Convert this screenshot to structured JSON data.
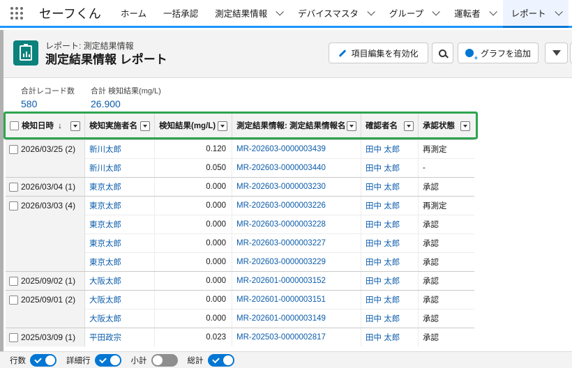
{
  "app": {
    "name": "セーフくん"
  },
  "nav": [
    {
      "label": "ホーム",
      "has_menu": false,
      "active": false
    },
    {
      "label": "一括承認",
      "has_menu": false,
      "active": false
    },
    {
      "label": "測定結果情報",
      "has_menu": true,
      "active": false
    },
    {
      "label": "デバイスマスタ",
      "has_menu": true,
      "active": false
    },
    {
      "label": "グループ",
      "has_menu": true,
      "active": false
    },
    {
      "label": "運転者",
      "has_menu": true,
      "active": false
    },
    {
      "label": "レポート",
      "has_menu": true,
      "active": true
    }
  ],
  "header": {
    "breadcrumb": "レポート: 測定結果情報",
    "title": "測定結果情報 レポート",
    "edit_button": "項目編集を有効化",
    "add_chart_button": "グラフを追加"
  },
  "summary": [
    {
      "label": "合計レコード数",
      "value": "580"
    },
    {
      "label": "合計 検知結果(mg/L)",
      "value": "26.900"
    }
  ],
  "table": {
    "columns": [
      "検知日時",
      "検知実施者名",
      "検知結果(mg/L)",
      "測定結果情報: 測定結果情報名",
      "確認者名",
      "承認状態"
    ],
    "sort_indicator": "↓",
    "groups": [
      {
        "label": "2026/03/25 (2)",
        "rows": [
          {
            "name": "新川太郎",
            "value": "0.120",
            "id": "MR-202603-0000003439",
            "confirmer": "田中 太郎",
            "status": "再測定"
          },
          {
            "name": "新川太郎",
            "value": "0.050",
            "id": "MR-202603-0000003440",
            "confirmer": "田中 太郎",
            "status": "-"
          }
        ]
      },
      {
        "label": "2026/03/04 (1)",
        "rows": [
          {
            "name": "東京太郎",
            "value": "0.000",
            "id": "MR-202603-0000003230",
            "confirmer": "田中 太郎",
            "status": "承認"
          }
        ]
      },
      {
        "label": "2026/03/03 (4)",
        "rows": [
          {
            "name": "東京太郎",
            "value": "0.000",
            "id": "MR-202603-0000003226",
            "confirmer": "田中 太郎",
            "status": "再測定"
          },
          {
            "name": "東京太郎",
            "value": "0.000",
            "id": "MR-202603-0000003228",
            "confirmer": "田中 太郎",
            "status": "承認"
          },
          {
            "name": "東京太郎",
            "value": "0.000",
            "id": "MR-202603-0000003227",
            "confirmer": "田中 太郎",
            "status": "承認"
          },
          {
            "name": "東京太郎",
            "value": "0.000",
            "id": "MR-202603-0000003229",
            "confirmer": "田中 太郎",
            "status": "承認"
          }
        ]
      },
      {
        "label": "2025/09/02 (1)",
        "rows": [
          {
            "name": "大阪太郎",
            "value": "0.000",
            "id": "MR-202601-0000003152",
            "confirmer": "田中 太郎",
            "status": "承認"
          }
        ]
      },
      {
        "label": "2025/09/01 (2)",
        "rows": [
          {
            "name": "大阪太郎",
            "value": "0.000",
            "id": "MR-202601-0000003151",
            "confirmer": "田中 太郎",
            "status": "承認"
          },
          {
            "name": "大阪太郎",
            "value": "0.000",
            "id": "MR-202601-0000003149",
            "confirmer": "田中 太郎",
            "status": "承認"
          }
        ]
      },
      {
        "label": "2025/03/09 (1)",
        "rows": [
          {
            "name": "平田政宗",
            "value": "0.023",
            "id": "MR-202503-0000002817",
            "confirmer": "田中 太郎",
            "status": "承認"
          }
        ]
      }
    ]
  },
  "footer": {
    "toggles": [
      {
        "label": "行数",
        "on": true
      },
      {
        "label": "詳細行",
        "on": true
      },
      {
        "label": "小計",
        "on": false
      },
      {
        "label": "総計",
        "on": true
      }
    ]
  },
  "colors": {
    "brand": "#0176d3",
    "highlight_border": "#2ea44f",
    "report_icon": "#0b827c",
    "link": "#0b5cab"
  }
}
